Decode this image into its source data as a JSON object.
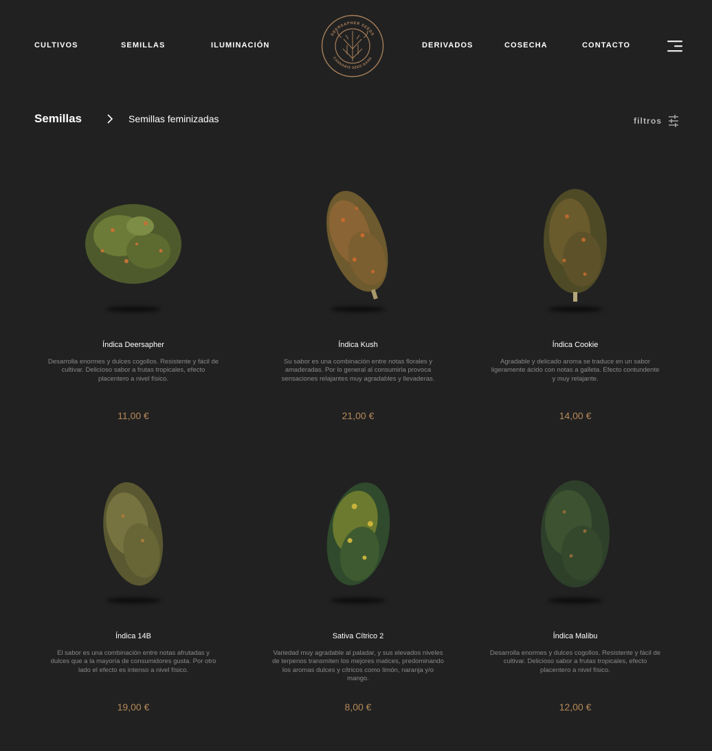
{
  "nav": {
    "left": [
      "CULTIVOS",
      "SEMILLAS",
      "ILUMINACIÓN"
    ],
    "right": [
      "DERIVADOS",
      "COSECHA",
      "CONTACTO"
    ]
  },
  "logo": {
    "top_text": "DEERSAPHER SEEDS",
    "bottom_text": "CANNABIS SEED BANK",
    "color": "#a9815b"
  },
  "breadcrumb": {
    "root": "Semillas",
    "current": "Semillas feminizadas"
  },
  "filters": {
    "label": "filtros"
  },
  "colors": {
    "background": "#212121",
    "price": "#b58a5a",
    "description": "#8a8a8a"
  },
  "products": [
    {
      "name": "Índica Deersapher",
      "description": "Desarrolla enormes y dulces cogollos. Resistente y fácil de cultivar. Delicioso sabor a frutas tropicales, efecto placentero a nivel físico.",
      "price": "11,00 €"
    },
    {
      "name": "Índica Kush",
      "description": "Su sabor es una combinación entre notas florales y amaderadas. Por lo general al consumirla provoca sensaciones relajantes muy agradables y llevaderas.",
      "price": "21,00 €"
    },
    {
      "name": "Índica Cookie",
      "description": "Agradable y delicado aroma se traduce en un sabor ligeramente ácido con notas a galleta. Efecto contundente y muy relajante.",
      "price": "14,00 €"
    },
    {
      "name": "Índica 14B",
      "description": "El sabor es una combinación entre notas afrutadas y dulces que a la mayoría de consumidores gusta. Por otro lado el efecto es intenso a nivel físico.",
      "price": "19,00 €"
    },
    {
      "name": "Sativa Cítrico 2",
      "description": "Variedad muy agradable al paladar, y sus elevados niveles de terpenos transmiten los mejores matices, predominando los aromas dulces y cítricos como limón, naranja y/o mango.",
      "price": "8,00 €"
    },
    {
      "name": "Índica Malibu",
      "description": "Desarrolla enormes y dulces cogollos. Resistente y fácil de cultivar. Delicioso sabor a frutas tropicales, efecto placentero a nivel físico.",
      "price": "12,00 €"
    }
  ]
}
